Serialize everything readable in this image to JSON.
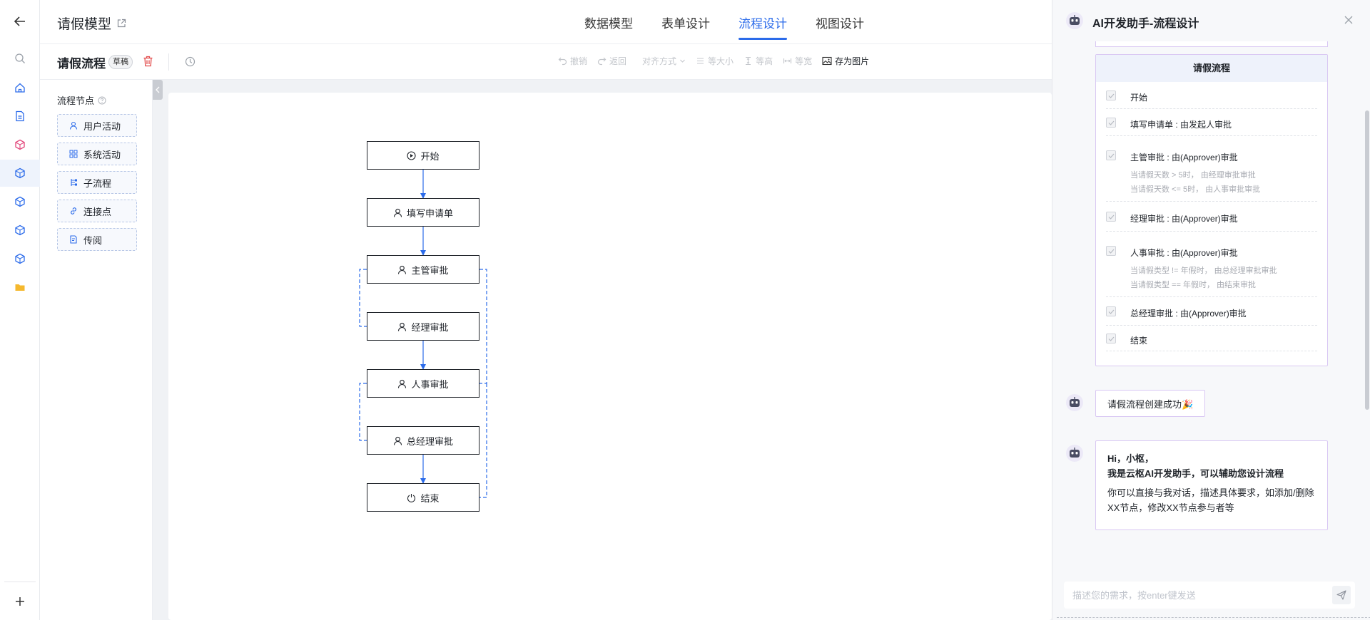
{
  "header": {
    "project_title": "请假模型",
    "tabs": [
      {
        "label": "数据模型",
        "active": false
      },
      {
        "label": "表单设计",
        "active": false
      },
      {
        "label": "流程设计",
        "active": true
      },
      {
        "label": "视图设计",
        "active": false
      }
    ],
    "accent_color": "#2b6bea"
  },
  "toolbar": {
    "flow_title": "请假流程",
    "status_badge": "草稿",
    "tools": [
      {
        "label": "撤销",
        "icon": "undo-icon",
        "enabled": false
      },
      {
        "label": "返回",
        "icon": "redo-icon",
        "enabled": false
      },
      {
        "label": "对齐方式",
        "icon": "chevron-down-icon",
        "enabled": false
      },
      {
        "label": "等大小",
        "icon": "same-size-icon",
        "enabled": false
      },
      {
        "label": "等高",
        "icon": "same-height-icon",
        "enabled": false
      },
      {
        "label": "等宽",
        "icon": "same-width-icon",
        "enabled": false
      },
      {
        "label": "存为图片",
        "icon": "image-icon",
        "enabled": true
      }
    ]
  },
  "sidebar": {
    "icons": [
      "back-arrow-icon",
      "search-icon",
      "home-icon",
      "document-icon",
      "cube-red-icon",
      "cube-icon",
      "cube-icon",
      "cube-icon",
      "cube-icon",
      "folder-icon",
      "plus-icon"
    ]
  },
  "node_panel": {
    "title": "流程节点",
    "items": [
      {
        "label": "用户活动",
        "icon": "user-icon"
      },
      {
        "label": "系统活动",
        "icon": "grid-icon"
      },
      {
        "label": "子流程",
        "icon": "subflow-icon"
      },
      {
        "label": "连接点",
        "icon": "link-icon"
      },
      {
        "label": "传阅",
        "icon": "circulate-icon"
      }
    ]
  },
  "flow": {
    "nodes": [
      {
        "id": "start",
        "label": "开始",
        "icon": "play-circle-icon"
      },
      {
        "id": "fill",
        "label": "填写申请单",
        "icon": "user-icon"
      },
      {
        "id": "sup",
        "label": "主管审批",
        "icon": "user-icon"
      },
      {
        "id": "mgr",
        "label": "经理审批",
        "icon": "user-icon"
      },
      {
        "id": "hr",
        "label": "人事审批",
        "icon": "user-icon"
      },
      {
        "id": "gm",
        "label": "总经理审批",
        "icon": "user-icon"
      },
      {
        "id": "end",
        "label": "结束",
        "icon": "power-icon"
      }
    ]
  },
  "ai_panel": {
    "title": "AI开发助手-流程设计",
    "plan": {
      "title": "请假流程",
      "items": [
        {
          "label": "开始",
          "subs": []
        },
        {
          "label": "填写申请单 : 由发起人审批",
          "subs": []
        },
        {
          "label": "主管审批 : 由(Approver)审批",
          "subs": [
            "当请假天数 > 5时， 由经理审批审批",
            "当请假天数 <= 5时， 由人事审批审批"
          ]
        },
        {
          "label": "经理审批 : 由(Approver)审批",
          "subs": []
        },
        {
          "label": "人事审批 : 由(Approver)审批",
          "subs": [
            "当请假类型 != 年假时， 由总经理审批审批",
            "当请假类型 == 年假时， 由结束审批"
          ]
        },
        {
          "label": "总经理审批 : 由(Approver)审批",
          "subs": []
        },
        {
          "label": "结束",
          "subs": []
        }
      ]
    },
    "success_message": "请假流程创建成功🎉",
    "greeting": {
      "line1": "Hi，小枢，",
      "line2": "我是云枢AI开发助手，可以辅助您设计流程",
      "body": "你可以直接与我对话，描述具体要求，如添加/删除XX节点，修改XX节点参与者等"
    },
    "input": {
      "placeholder": "描述您的需求，按enter键发送",
      "value": ""
    }
  }
}
